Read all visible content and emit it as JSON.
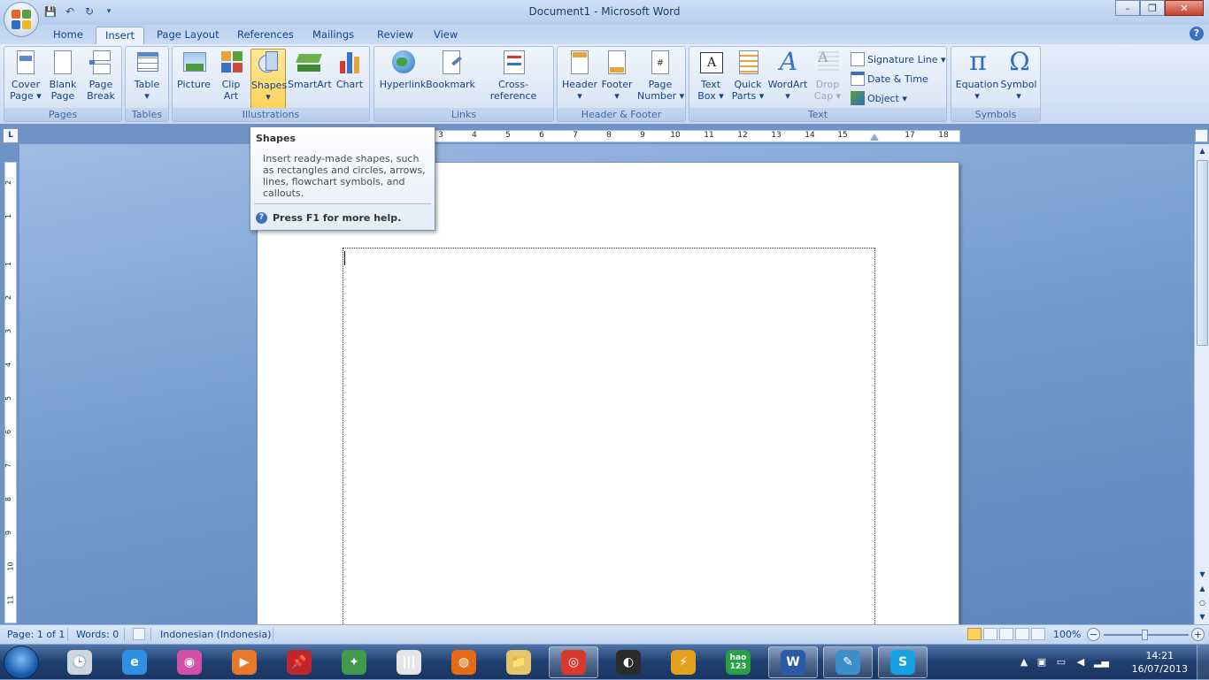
{
  "window": {
    "title": "Document1 - Microsoft Word",
    "minimize": "–",
    "maximize": "❐",
    "close": "✕"
  },
  "qat": {
    "save_icon": "💾",
    "undo_icon": "↶",
    "redo_icon": "↻",
    "more_icon": "▾"
  },
  "tabs": [
    {
      "label": "Home"
    },
    {
      "label": "Insert"
    },
    {
      "label": "Page Layout"
    },
    {
      "label": "References"
    },
    {
      "label": "Mailings"
    },
    {
      "label": "Review"
    },
    {
      "label": "View"
    }
  ],
  "help_icon": "?",
  "ribbon": {
    "groups": {
      "pages": "Pages",
      "tables": "Tables",
      "illustrations": "Illustrations",
      "links": "Links",
      "header_footer": "Header & Footer",
      "text": "Text",
      "symbols": "Symbols"
    },
    "buttons": {
      "cover_page": "Cover\nPage ▾",
      "blank_page": "Blank\nPage",
      "page_break": "Page\nBreak",
      "table": "Table\n▾",
      "picture": "Picture",
      "clip_art": "Clip\nArt",
      "shapes": "Shapes\n▾",
      "smartart": "SmartArt",
      "chart": "Chart",
      "hyperlink": "Hyperlink",
      "bookmark": "Bookmark",
      "cross_reference": "Cross-reference",
      "header": "Header\n▾",
      "footer": "Footer\n▾",
      "page_number": "Page\nNumber ▾",
      "text_box": "Text\nBox ▾",
      "quick_parts": "Quick\nParts ▾",
      "wordart": "WordArt\n▾",
      "drop_cap": "Drop\nCap ▾",
      "signature_line": "Signature Line ▾",
      "date_time": "Date & Time",
      "object": "Object ▾",
      "equation": "Equation\n▾",
      "symbol": "Symbol\n▾"
    }
  },
  "ruler": {
    "corner": "L",
    "ticks": [
      "3",
      "4",
      "5",
      "6",
      "7",
      "8",
      "9",
      "10",
      "11",
      "12",
      "13",
      "14",
      "15",
      "17",
      "18"
    ],
    "vticks": [
      "2",
      "1",
      "1",
      "2",
      "3",
      "4",
      "5",
      "6",
      "7",
      "8",
      "9",
      "10",
      "11"
    ]
  },
  "tooltip": {
    "title": "Shapes",
    "body": "Insert ready-made shapes, such as rectangles and circles, arrows, lines, flowchart symbols, and callouts.",
    "help": "Press F1 for more help."
  },
  "status": {
    "page": "Page: 1 of 1",
    "words": "Words: 0",
    "language": "Indonesian (Indonesia)",
    "zoom": "100%"
  },
  "taskbar": {
    "apps": [
      {
        "name": "Clock",
        "glyph": "🕒",
        "color": "#cfd6df"
      },
      {
        "name": "Internet Explorer",
        "glyph": "e",
        "color": "#2f8fe0"
      },
      {
        "name": "Picasa",
        "glyph": "◉",
        "color": "#d24fa8"
      },
      {
        "name": "Media Player",
        "glyph": "▶",
        "color": "#e8782b"
      },
      {
        "name": "Pin",
        "glyph": "📌",
        "color": "#c0262b"
      },
      {
        "name": "App",
        "glyph": "✦",
        "color": "#3f9a4c"
      },
      {
        "name": "Barcode",
        "glyph": "|||",
        "color": "#e5e5e5"
      },
      {
        "name": "Firefox",
        "glyph": "◍",
        "color": "#e56a16"
      },
      {
        "name": "Explorer",
        "glyph": "📁",
        "color": "#e4c56a"
      },
      {
        "name": "Chrome",
        "glyph": "◎",
        "color": "#d9392b"
      },
      {
        "name": "Media",
        "glyph": "◐",
        "color": "#2b2b2b"
      },
      {
        "name": "Winamp",
        "glyph": "⚡",
        "color": "#e3a11e"
      },
      {
        "name": "hao123",
        "glyph": "hao\n123",
        "color": "#2aa046"
      },
      {
        "name": "Word",
        "glyph": "W",
        "color": "#2a5aa8"
      },
      {
        "name": "Feather",
        "glyph": "✎",
        "color": "#3d8fc7"
      },
      {
        "name": "Skype",
        "glyph": "S",
        "color": "#16a2e2"
      }
    ],
    "time": "14:21",
    "date": "16/07/2013"
  }
}
